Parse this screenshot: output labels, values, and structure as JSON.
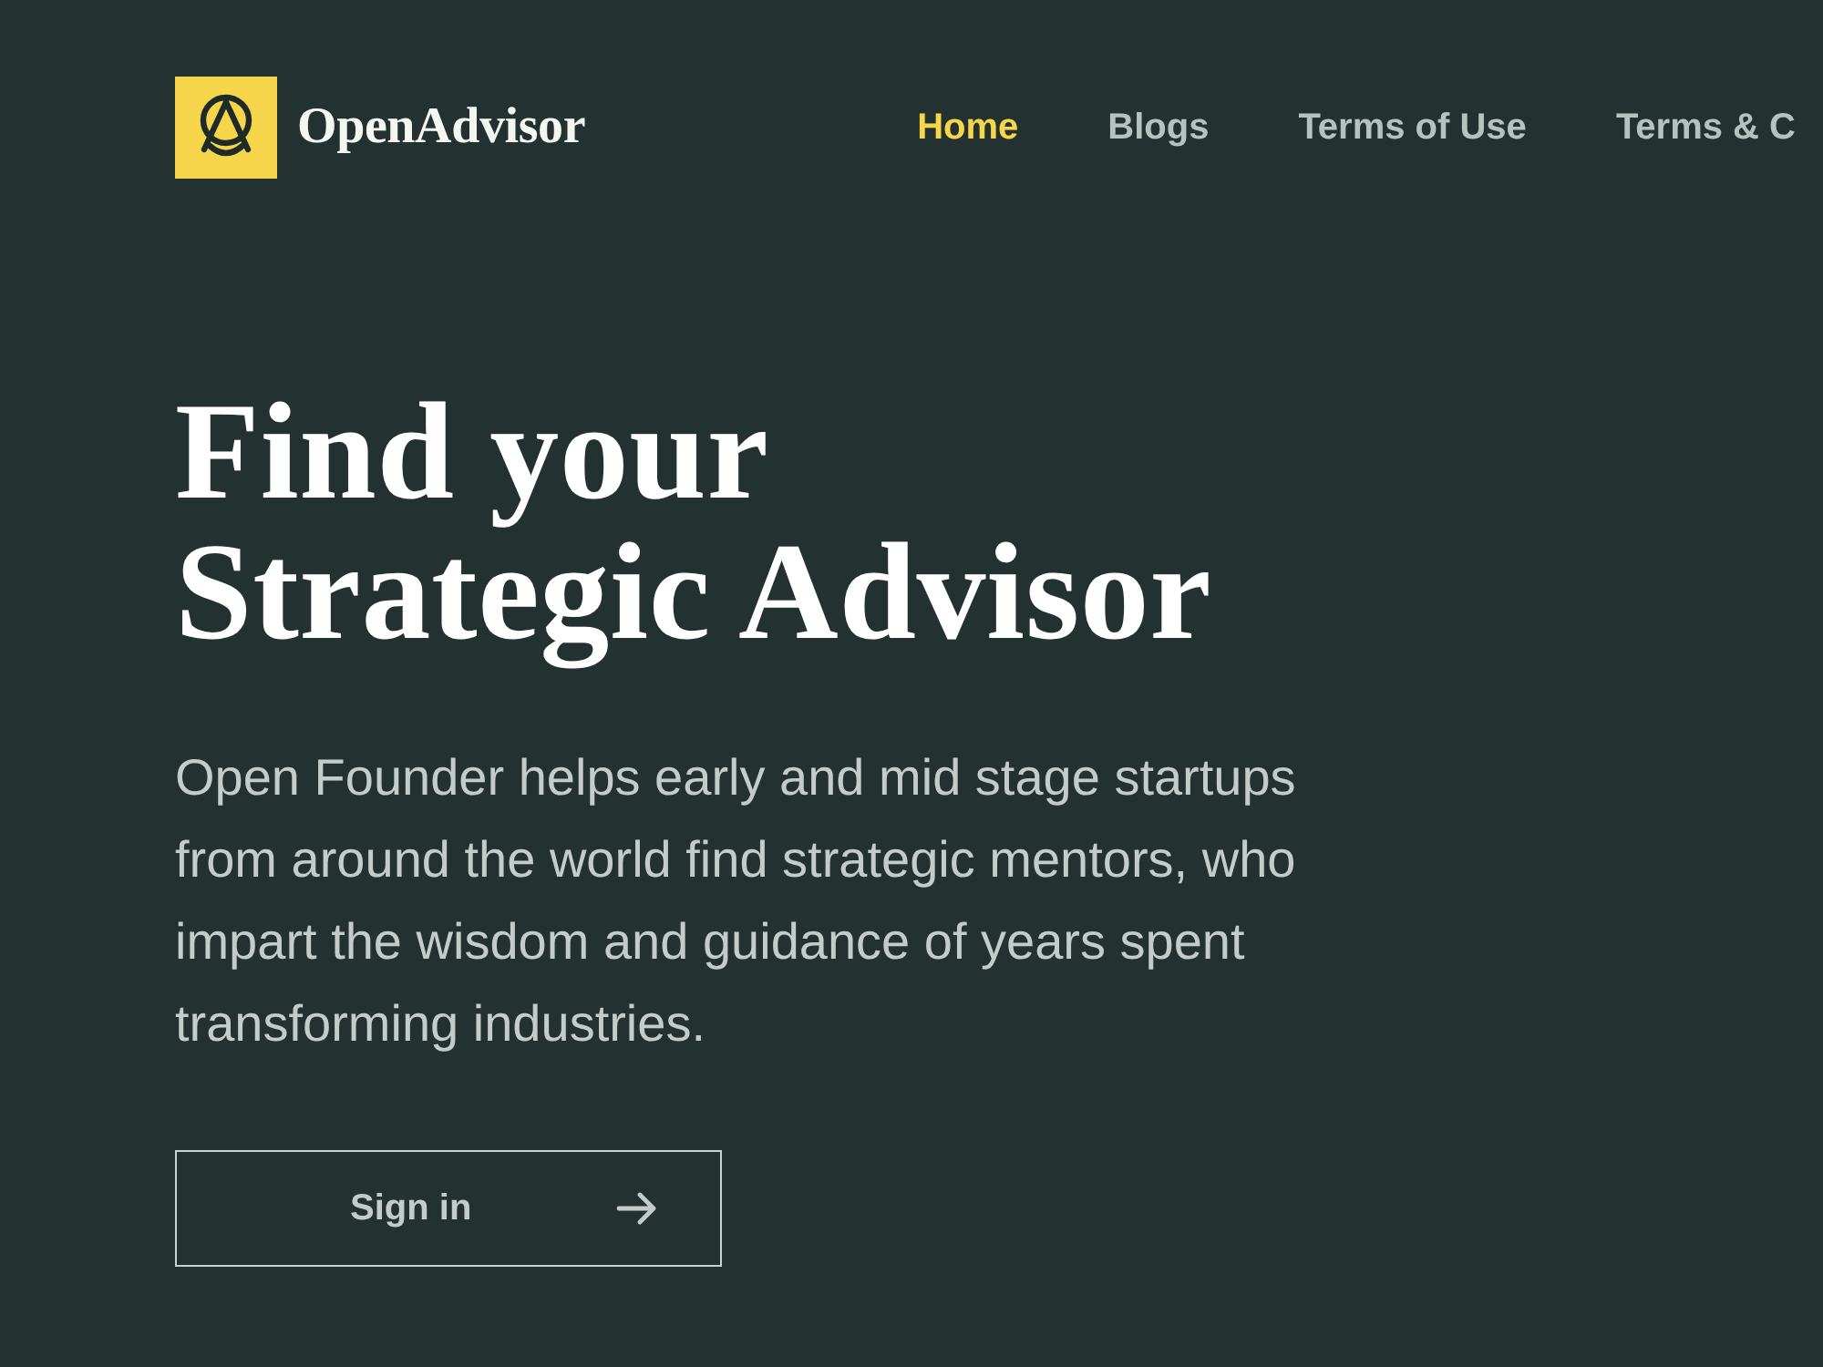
{
  "brand": {
    "name": "OpenAdvisor"
  },
  "nav": [
    {
      "label": "Home",
      "selected": true
    },
    {
      "label": "Blogs",
      "selected": false
    },
    {
      "label": "Terms of Use",
      "selected": false
    },
    {
      "label": "Terms & C",
      "selected": false
    }
  ],
  "hero": {
    "title_lines": [
      "Find your",
      "Strategic Advisor"
    ],
    "description": "Open Founder helps early and mid stage startups from around the world find strategic mentors, who impart the wisdom and guidance of years spent transforming industries.",
    "button": {
      "label": "Sign in"
    }
  }
}
